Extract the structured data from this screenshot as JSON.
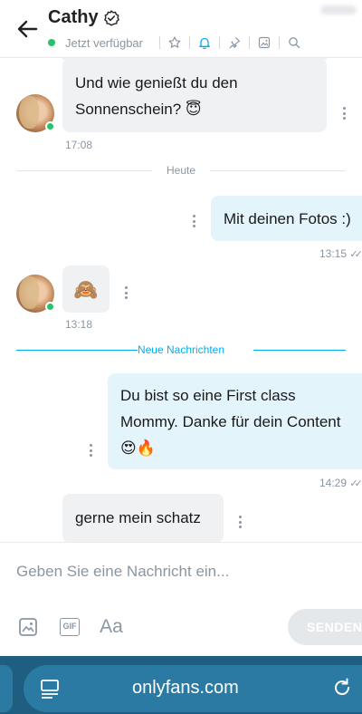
{
  "header": {
    "contact_name": "Cathy",
    "status": "Jetzt verfügbar",
    "icons": [
      "back-arrow-icon",
      "verified-icon",
      "star-icon",
      "bell-icon",
      "pin-icon",
      "gallery-icon",
      "search-icon"
    ]
  },
  "messages": {
    "m1": {
      "text_line1": "Und wie genießt du den",
      "text_line2": "Sonnenschein? 😇",
      "time": "17:08"
    },
    "divider_today": "Heute",
    "m2": {
      "text": "Mit deinen Fotos :)",
      "time": "13:15"
    },
    "m3": {
      "emoji": "🙈",
      "time": "13:18"
    },
    "divider_new": "Neue Nachrichten",
    "m4": {
      "line1": "Du bist so eine First class",
      "line2": "Mommy. Danke für dein Content",
      "line3": "😍🔥",
      "time": "14:29"
    },
    "m5": {
      "text": "gerne mein schatz"
    }
  },
  "composer": {
    "placeholder": "Geben Sie eine Nachricht ein...",
    "gif_label": "GIF",
    "font_label": "Aa",
    "send_label": "SENDEN"
  },
  "browser": {
    "url": "onlyfans.com"
  },
  "colors": {
    "accent": "#00aff0",
    "online": "#27c26a",
    "incoming_bubble": "#f0f1f3",
    "outgoing_bubble": "#e3f4fb",
    "browser_bar": "#1f5e80"
  }
}
